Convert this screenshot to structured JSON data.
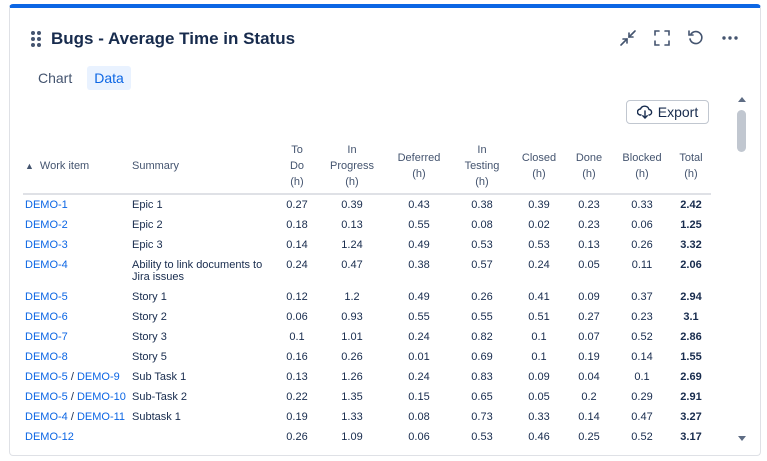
{
  "header": {
    "title": "Bugs - Average Time in Status"
  },
  "tabs": [
    {
      "label": "Chart",
      "active": false
    },
    {
      "label": "Data",
      "active": true
    }
  ],
  "export_label": "Export",
  "table": {
    "sort_arrow": "^",
    "columns": {
      "work_item": "Work item",
      "summary": "Summary",
      "to_do": [
        "To",
        "Do",
        "(h)"
      ],
      "in_progress": [
        "In",
        "Progress",
        "(h)"
      ],
      "deferred": [
        "Deferred",
        "(h)"
      ],
      "in_testing": [
        "In",
        "Testing",
        "(h)"
      ],
      "closed": [
        "Closed",
        "(h)"
      ],
      "done": [
        "Done",
        "(h)"
      ],
      "blocked": [
        "Blocked",
        "(h)"
      ],
      "total": [
        "Total",
        "(h)"
      ]
    },
    "rows": [
      {
        "keys": [
          "DEMO-1"
        ],
        "summary": "Epic 1",
        "to_do": "0.27",
        "in_progress": "0.39",
        "deferred": "0.43",
        "in_testing": "0.38",
        "closed": "0.39",
        "done": "0.23",
        "blocked": "0.33",
        "total": "2.42"
      },
      {
        "keys": [
          "DEMO-2"
        ],
        "summary": "Epic 2",
        "to_do": "0.18",
        "in_progress": "0.13",
        "deferred": "0.55",
        "in_testing": "0.08",
        "closed": "0.02",
        "done": "0.23",
        "blocked": "0.06",
        "total": "1.25"
      },
      {
        "keys": [
          "DEMO-3"
        ],
        "summary": "Epic 3",
        "to_do": "0.14",
        "in_progress": "1.24",
        "deferred": "0.49",
        "in_testing": "0.53",
        "closed": "0.53",
        "done": "0.13",
        "blocked": "0.26",
        "total": "3.32"
      },
      {
        "keys": [
          "DEMO-4"
        ],
        "summary": "Ability to link documents to Jira issues",
        "to_do": "0.24",
        "in_progress": "0.47",
        "deferred": "0.38",
        "in_testing": "0.57",
        "closed": "0.24",
        "done": "0.05",
        "blocked": "0.11",
        "total": "2.06"
      },
      {
        "keys": [
          "DEMO-5"
        ],
        "summary": "Story 1",
        "to_do": "0.12",
        "in_progress": "1.2",
        "deferred": "0.49",
        "in_testing": "0.26",
        "closed": "0.41",
        "done": "0.09",
        "blocked": "0.37",
        "total": "2.94"
      },
      {
        "keys": [
          "DEMO-6"
        ],
        "summary": "Story 2",
        "to_do": "0.06",
        "in_progress": "0.93",
        "deferred": "0.55",
        "in_testing": "0.55",
        "closed": "0.51",
        "done": "0.27",
        "blocked": "0.23",
        "total": "3.1"
      },
      {
        "keys": [
          "DEMO-7"
        ],
        "summary": "Story 3",
        "to_do": "0.1",
        "in_progress": "1.01",
        "deferred": "0.24",
        "in_testing": "0.82",
        "closed": "0.1",
        "done": "0.07",
        "blocked": "0.52",
        "total": "2.86"
      },
      {
        "keys": [
          "DEMO-8"
        ],
        "summary": "Story 5",
        "to_do": "0.16",
        "in_progress": "0.26",
        "deferred": "0.01",
        "in_testing": "0.69",
        "closed": "0.1",
        "done": "0.19",
        "blocked": "0.14",
        "total": "1.55"
      },
      {
        "keys": [
          "DEMO-5",
          "DEMO-9"
        ],
        "summary": "Sub Task 1",
        "to_do": "0.13",
        "in_progress": "1.26",
        "deferred": "0.24",
        "in_testing": "0.83",
        "closed": "0.09",
        "done": "0.04",
        "blocked": "0.1",
        "total": "2.69"
      },
      {
        "keys": [
          "DEMO-5",
          "DEMO-10"
        ],
        "summary": "Sub-Task 2",
        "to_do": "0.22",
        "in_progress": "1.35",
        "deferred": "0.15",
        "in_testing": "0.65",
        "closed": "0.05",
        "done": "0.2",
        "blocked": "0.29",
        "total": "2.91"
      },
      {
        "keys": [
          "DEMO-4",
          "DEMO-11"
        ],
        "summary": "Subtask 1",
        "to_do": "0.19",
        "in_progress": "1.33",
        "deferred": "0.08",
        "in_testing": "0.73",
        "closed": "0.33",
        "done": "0.14",
        "blocked": "0.47",
        "total": "3.27"
      },
      {
        "keys": [
          "DEMO-12"
        ],
        "summary": "",
        "to_do": "0.26",
        "in_progress": "1.09",
        "deferred": "0.06",
        "in_testing": "0.53",
        "closed": "0.46",
        "done": "0.25",
        "blocked": "0.52",
        "total": "3.17"
      }
    ]
  }
}
